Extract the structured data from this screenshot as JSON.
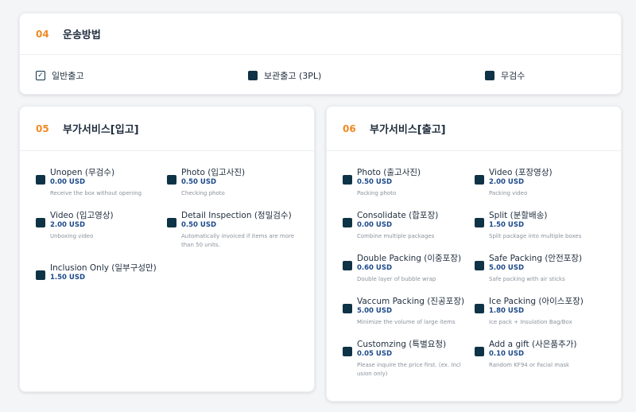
{
  "section04": {
    "num": "04",
    "title": "운송방법",
    "options": [
      {
        "label": "일반출고",
        "checked": true
      },
      {
        "label": "보관출고 (3PL)",
        "checked": false
      },
      {
        "label": "무검수",
        "checked": false
      }
    ]
  },
  "section05": {
    "num": "05",
    "title": "부가서비스[입고]",
    "items": [
      {
        "name": "Unopen (무검수)",
        "price": "0.00 USD",
        "desc": "Receive the box without opening"
      },
      {
        "name": "Photo (입고사진)",
        "price": "0.50 USD",
        "desc": "Checking photo"
      },
      {
        "name": "Video (입고영상)",
        "price": "2.00 USD",
        "desc": "Unboxing video"
      },
      {
        "name": "Detail Inspection (정밀검수)",
        "price": "0.50 USD",
        "desc": "Automatically invoiced if items are more than 50 units."
      },
      {
        "name": "Inclusion Only (일부구성만)",
        "price": "1.50 USD",
        "desc": ""
      }
    ]
  },
  "section06": {
    "num": "06",
    "title": "부가서비스[출고]",
    "items": [
      {
        "name": "Photo (출고사진)",
        "price": "0.50 USD",
        "desc": "Packing photo"
      },
      {
        "name": "Video (포장영상)",
        "price": "2.00 USD",
        "desc": "Packing video"
      },
      {
        "name": "Consolidate (합포장)",
        "price": "0.00 USD",
        "desc": "Combine multiple packages"
      },
      {
        "name": "Split (분할배송)",
        "price": "1.50 USD",
        "desc": "Split package into multiple boxes"
      },
      {
        "name": "Double Packing (이중포장)",
        "price": "0.60 USD",
        "desc": "Double layer of bubble wrap"
      },
      {
        "name": "Safe Packing (안전포장)",
        "price": "5.00 USD",
        "desc": "Safe packing with air sticks"
      },
      {
        "name": "Vaccum Packing (진공포장)",
        "price": "5.00 USD",
        "desc": "Minimize the volume of large items"
      },
      {
        "name": "Ice Packing (아이스포장)",
        "price": "1.80 USD",
        "desc": "Ice pack + Insulation Bag/Box"
      },
      {
        "name": "Customzing (특별요청)",
        "price": "0.05 USD",
        "desc": "Please inquire the price first. (ex. Incl usion only)"
      },
      {
        "name": "Add a gift (사은품추가)",
        "price": "0.10 USD",
        "desc": "Random KF94 or Facial mask"
      }
    ]
  }
}
